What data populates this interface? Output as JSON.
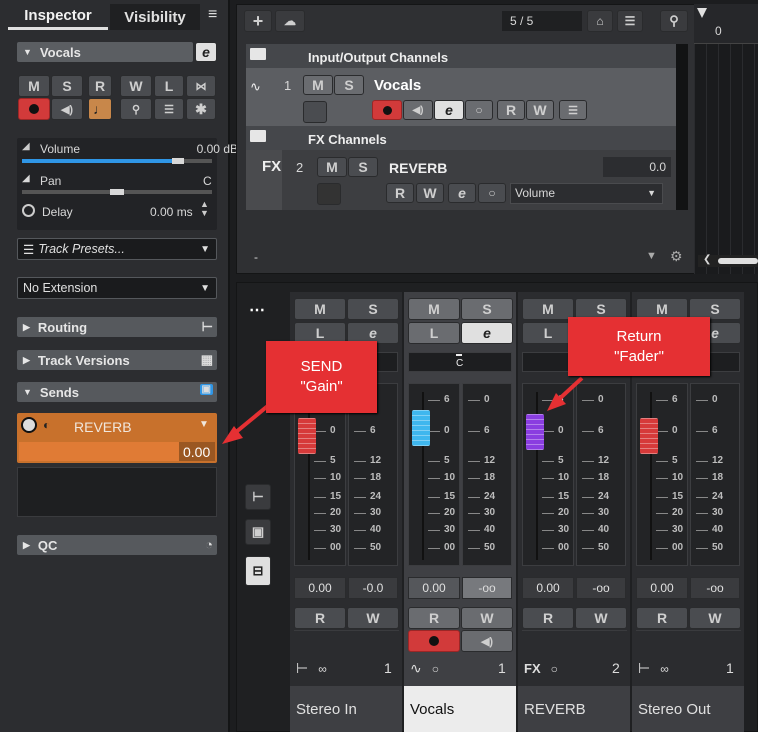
{
  "inspector": {
    "tab_inspector": "Inspector",
    "tab_visibility": "Visibility",
    "track_name": "Vocals",
    "btn_m": "M",
    "btn_s": "S",
    "btn_r": "R",
    "btn_w": "W",
    "btn_l": "L",
    "volume_label": "Volume",
    "volume_value": "0.00 dB",
    "pan_label": "Pan",
    "pan_value": "C",
    "delay_label": "Delay",
    "delay_value": "0.00 ms",
    "track_presets": "Track Presets...",
    "extension": "No Extension",
    "routing": "Routing",
    "track_versions": "Track Versions",
    "sends": "Sends",
    "send_name": "REVERB",
    "send_value": "0.00",
    "qc": "QC"
  },
  "project": {
    "counter": "5 / 5",
    "ruler_start": "0",
    "folder_io": "Input/Output Channels",
    "track1_num": "1",
    "track1_name": "Vocals",
    "folder_fx": "FX Channels",
    "fx_label": "FX",
    "track2_num": "2",
    "track2_name": "REVERB",
    "track2_value": "0.0",
    "track2_param": "Volume",
    "dash": "-",
    "btn_m": "M",
    "btn_s": "S",
    "btn_r": "R",
    "btn_w": "W"
  },
  "mixer": {
    "btn_m": "M",
    "btn_s": "S",
    "btn_l": "L",
    "btn_r": "R",
    "btn_w": "W",
    "pan_c": "C",
    "scale_left": [
      "6",
      "0",
      "5",
      "10",
      "15",
      "20",
      "30",
      "00"
    ],
    "scale_right": [
      "0",
      "6",
      "12",
      "18",
      "24",
      "30",
      "40",
      "50"
    ],
    "channels": [
      {
        "name": "Stereo In",
        "num": "1",
        "vol": "0.00",
        "peak": "-0.0"
      },
      {
        "name": "Vocals",
        "num": "1",
        "vol": "0.00",
        "peak": "-oo"
      },
      {
        "name": "REVERB",
        "num": "2",
        "vol": "0.00",
        "peak": "-oo",
        "fx": "FX"
      },
      {
        "name": "Stereo Out",
        "num": "1",
        "vol": "0.00",
        "peak": "-oo"
      }
    ]
  },
  "callouts": {
    "send_gain_1": "SEND",
    "send_gain_2": "\"Gain\"",
    "return_fader_1": "Return",
    "return_fader_2": "\"Fader\""
  },
  "colors": {
    "red": "#e53033",
    "accent_blue": "#2f96e6",
    "send_orange": "#c8712c"
  }
}
